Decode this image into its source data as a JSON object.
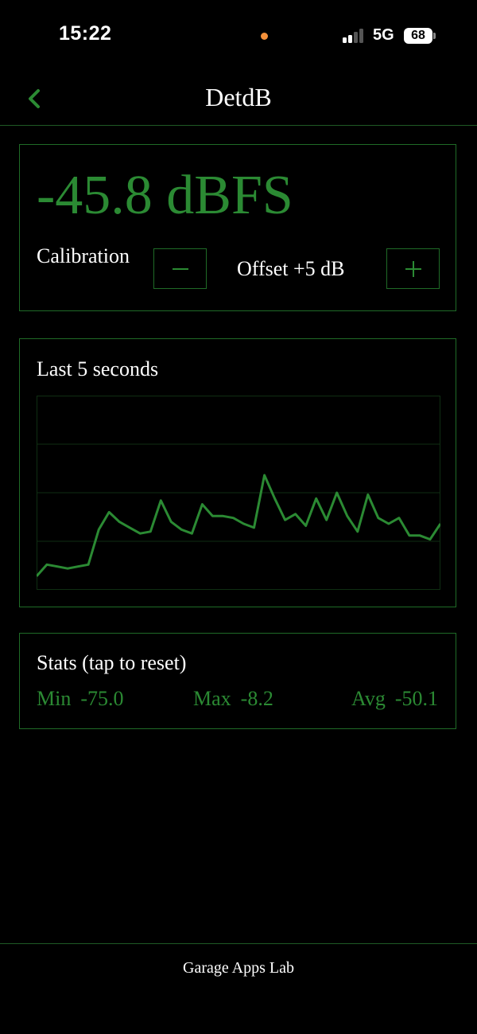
{
  "status_bar": {
    "time": "15:22",
    "network": "5G",
    "battery": "68",
    "recording_dot_color": "#f5913a"
  },
  "nav": {
    "title": "DetdB",
    "back_icon": "chevron-left-icon"
  },
  "level": {
    "readout": "-45.8 dBFS",
    "calibration_label": "Calibration",
    "offset_label": "Offset +5 dB",
    "minus_label": "−",
    "plus_label": "+"
  },
  "chart": {
    "title": "Last 5 seconds"
  },
  "chart_data": {
    "type": "line",
    "title": "Last 5 seconds",
    "xlabel": "",
    "ylabel": "",
    "grid": true,
    "ylim": [
      -100,
      0
    ],
    "y_gridlines": 4,
    "x_gridlines": 0,
    "series": [
      {
        "values": [
          -93,
          -87,
          -88,
          -89,
          -88,
          -87,
          -69,
          -60,
          -65,
          -68,
          -71,
          -70,
          -54,
          -65,
          -69,
          -71,
          -56,
          -62,
          -62,
          -63,
          -66,
          -68,
          -41,
          -53,
          -64,
          -61,
          -67,
          -53,
          -64,
          -50,
          -62,
          -70,
          -51,
          -63,
          -66,
          -63,
          -72,
          -72,
          -74,
          -66
        ]
      }
    ]
  },
  "stats": {
    "title": "Stats (tap to reset)",
    "min_label": "Min",
    "min_value": "-75.0",
    "max_label": "Max",
    "max_value": "-8.2",
    "avg_label": "Avg",
    "avg_value": "-50.1"
  },
  "footer": {
    "text": "Garage Apps Lab"
  },
  "colors": {
    "accent": "#2b8a33",
    "border": "#1f6b27",
    "grid": "#0f2e12",
    "background": "#000000",
    "text": "#ffffff"
  }
}
